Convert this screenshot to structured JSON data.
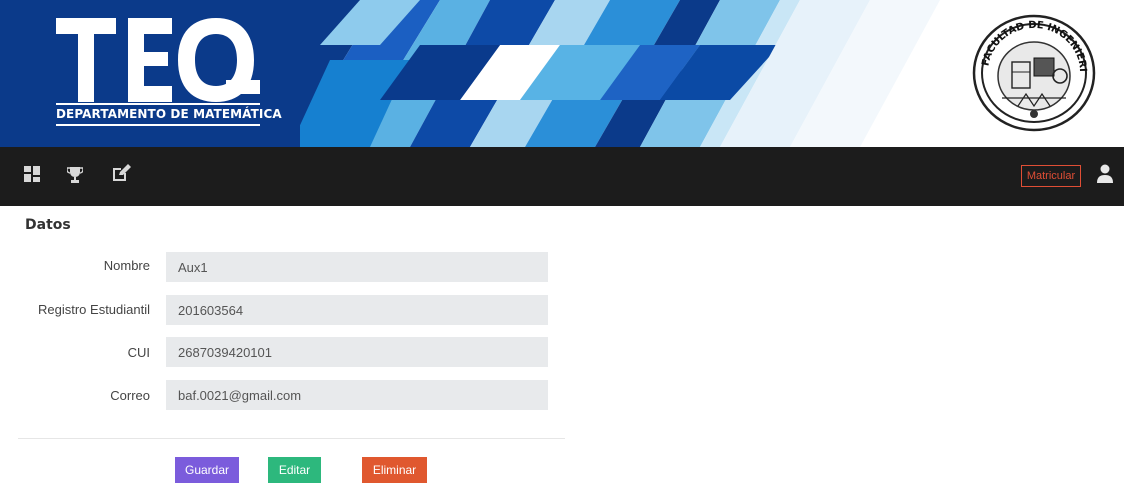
{
  "banner": {
    "logo_text": "TEQ",
    "subtitle": "DEPARTAMENTO DE MATEMÁTICA",
    "seal_text": "FACULTAD DE INGENIERIA USAC",
    "colors": {
      "dark_blue": "#0a3a8c",
      "mid_blue": "#1c63c6",
      "light_blue": "#5ab4e4",
      "pale_blue": "#a9d8f1"
    }
  },
  "navbar": {
    "icons": [
      "dashboard-icon",
      "trophy-icon",
      "edit-icon"
    ],
    "matricular_label": "Matricular",
    "user_icon": "user-icon",
    "accent": "#e04e35",
    "background": "#1c1c1c"
  },
  "form": {
    "title": "Datos",
    "fields": [
      {
        "label": "Nombre",
        "value": "Aux1"
      },
      {
        "label": "Registro Estudiantil",
        "value": "201603564"
      },
      {
        "label": "CUI",
        "value": "2687039420101"
      },
      {
        "label": "Correo",
        "value": "baf.0021@gmail.com"
      }
    ]
  },
  "actions": {
    "save_label": "Guardar",
    "edit_label": "Editar",
    "delete_label": "Eliminar",
    "save_color": "#7b5cdc",
    "edit_color": "#2db87d",
    "delete_color": "#e0582f"
  }
}
